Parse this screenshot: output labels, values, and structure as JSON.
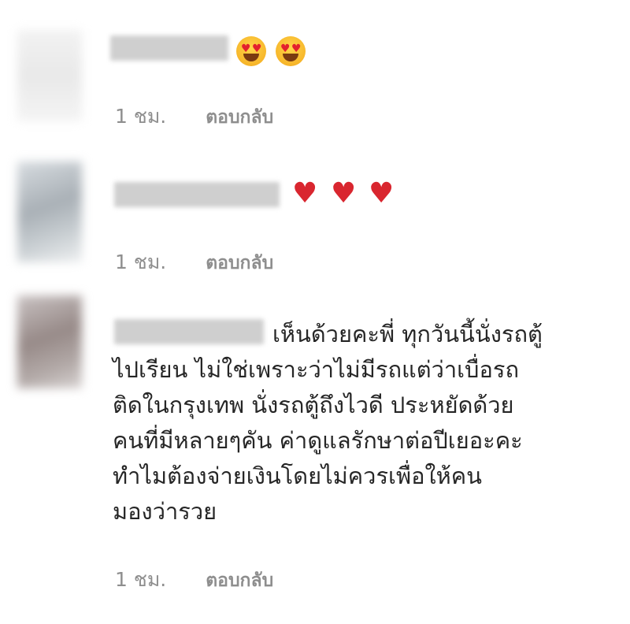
{
  "comments": [
    {
      "emojis": [
        "heart-eyes-emoji",
        "heart-eyes-emoji"
      ],
      "time": "1 ชม.",
      "reply": "ตอบกลับ"
    },
    {
      "emojis": [
        "red-heart",
        "red-heart",
        "red-heart"
      ],
      "time": "1 ชม.",
      "reply": "ตอบกลับ"
    },
    {
      "text_lines": [
        "เห็นด้วยคะพี่ ทุกวันนี้นั่งรถตู้",
        "ไปเรียน ไม่ใช่เพราะว่าไม่มีรถแต่ว่าเบื่อรถ",
        "ติดในกรุงเทพ นั่งรถตู้ถึงไวดี ประหยัดด้วย",
        "คนที่มีหลายๆคัน ค่าดูแลรักษาต่อปีเยอะคะ",
        "ทำไมต้องจ่ายเงินโดยไม่ควรเพื่อให้คน",
        "มองว่ารวย"
      ],
      "time": "1 ชม.",
      "reply": "ตอบกลับ"
    }
  ],
  "colors": {
    "text": "#262626",
    "meta": "#8e8e8e",
    "heart": "#d9262f"
  }
}
